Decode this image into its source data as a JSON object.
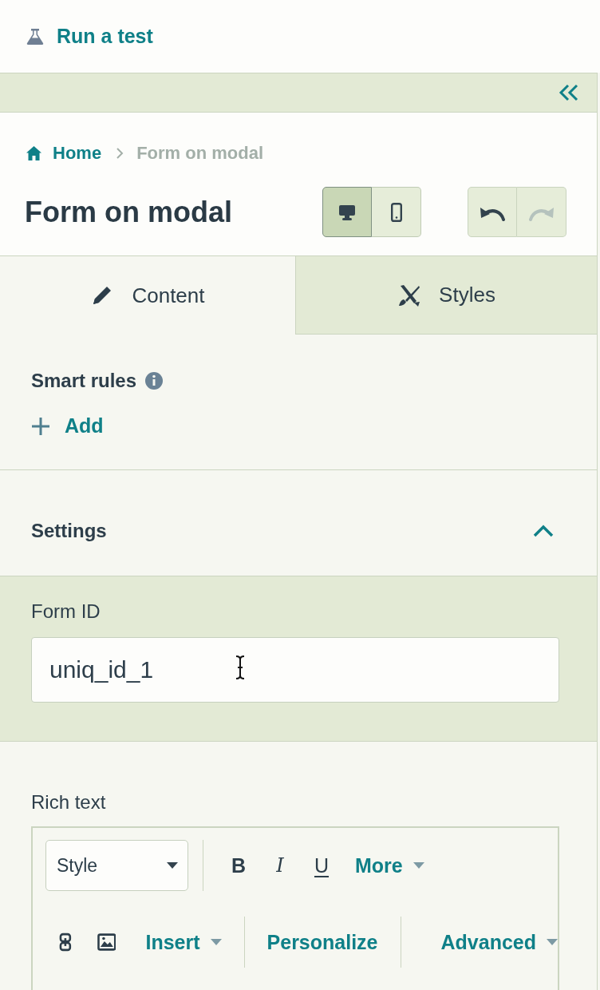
{
  "header": {
    "action": "Run a test"
  },
  "breadcrumb": [
    {
      "label": "Home",
      "kind": "home"
    },
    {
      "label": "Form on modal",
      "kind": "current"
    }
  ],
  "title": "Form on modal",
  "view_toggle": [
    {
      "kind": "desktop",
      "selected": true
    },
    {
      "kind": "mobile",
      "selected": false
    }
  ],
  "history": [
    {
      "kind": "undo",
      "disabled": false
    },
    {
      "kind": "redo",
      "disabled": true
    }
  ],
  "tabs": [
    {
      "label": "Content",
      "kind": "content",
      "selected": true
    },
    {
      "label": "Styles",
      "kind": "styles",
      "selected": false
    }
  ],
  "smart_rules": {
    "label": "Smart rules",
    "action": "Add"
  },
  "settings": {
    "title": "Settings",
    "expanded": true,
    "form_id": {
      "label": "Form ID",
      "value": "uniq_id_1"
    }
  },
  "rich_text": {
    "label": "Rich text",
    "toolbar_rows": [
      [
        {
          "kind": "select",
          "label": "Style"
        },
        {
          "kind": "separator"
        },
        {
          "kind": "bold",
          "label": "B"
        },
        {
          "kind": "italic",
          "label": "I"
        },
        {
          "kind": "underline",
          "label": "U"
        },
        {
          "kind": "menu",
          "label": "More"
        }
      ],
      [
        {
          "kind": "link"
        },
        {
          "kind": "image"
        },
        {
          "kind": "menu",
          "label": "Insert"
        },
        {
          "kind": "separator"
        },
        {
          "kind": "button",
          "label": "Personalize"
        },
        {
          "kind": "separator"
        },
        {
          "kind": "menu",
          "label": "Advanced"
        }
      ]
    ]
  }
}
